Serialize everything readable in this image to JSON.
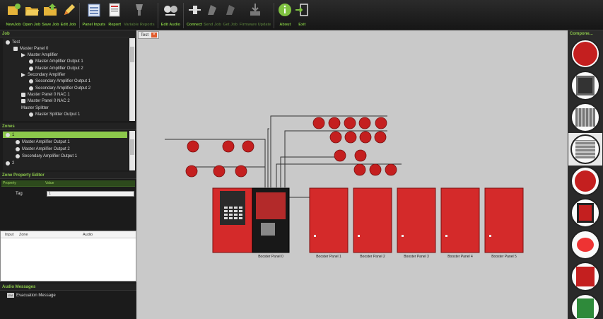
{
  "toolbar": {
    "buttons": [
      {
        "label": "NewJob",
        "icon": "new-job-icon",
        "enabled": true
      },
      {
        "label": "Open Job",
        "icon": "folder-open-icon",
        "enabled": true
      },
      {
        "label": "Save Job",
        "icon": "save-job-icon",
        "enabled": true
      },
      {
        "label": "Edit Job",
        "icon": "pencil-icon",
        "enabled": true
      },
      {
        "label": "Panel Inputs",
        "icon": "panel-inputs-icon",
        "enabled": true
      },
      {
        "label": "Report",
        "icon": "report-icon",
        "enabled": true
      },
      {
        "label": "Variable Reports",
        "icon": "variable-reports-icon",
        "enabled": false
      },
      {
        "label": "Edit Audio",
        "icon": "edit-audio-icon",
        "enabled": true
      },
      {
        "label": "Connect",
        "icon": "connect-plug-icon",
        "enabled": true
      },
      {
        "label": "Send Job",
        "icon": "send-job-icon",
        "enabled": false
      },
      {
        "label": "Get Job",
        "icon": "get-job-icon",
        "enabled": false
      },
      {
        "label": "Firmware Update",
        "icon": "firmware-update-icon",
        "enabled": false
      },
      {
        "label": "About",
        "icon": "info-icon",
        "enabled": true
      },
      {
        "label": "Exit",
        "icon": "exit-door-icon",
        "enabled": true
      }
    ]
  },
  "job_panel": {
    "title": "Job",
    "items": [
      {
        "label": "Test",
        "indent": 0,
        "icon": "wrench"
      },
      {
        "label": "Master Panel 0",
        "indent": 1,
        "icon": "panel"
      },
      {
        "label": "Master Amplifier",
        "indent": 2,
        "icon": "amp"
      },
      {
        "label": "Master Amplifier Output 1",
        "indent": 3,
        "icon": "out"
      },
      {
        "label": "Master Amplifier Output 2",
        "indent": 3,
        "icon": "out"
      },
      {
        "label": "Secondary Amplifier",
        "indent": 2,
        "icon": "amp"
      },
      {
        "label": "Secondary Amplifier Output 1",
        "indent": 3,
        "icon": "out"
      },
      {
        "label": "Secondary Amplifier Output 2",
        "indent": 3,
        "icon": "out"
      },
      {
        "label": "Master Panel 0 NAC 1",
        "indent": 2,
        "icon": "nac"
      },
      {
        "label": "Master Panel 0 NAC 2",
        "indent": 2,
        "icon": "nac"
      },
      {
        "label": "Master Splitter",
        "indent": 2,
        "icon": "none"
      },
      {
        "label": "Master Splitter Output 1",
        "indent": 3,
        "icon": "out"
      }
    ]
  },
  "zones_panel": {
    "title": "Zones",
    "items": [
      {
        "label": "1",
        "selected": true
      },
      {
        "label": "Master Amplifier Output 1",
        "selected": false
      },
      {
        "label": "Master Amplifier Output 2",
        "selected": false
      },
      {
        "label": "Secondary Amplifier Output 1",
        "selected": false
      },
      {
        "label": "2",
        "selected": false
      }
    ]
  },
  "zone_property_editor": {
    "title": "Zone Property Editor",
    "col_property": "Property",
    "col_value": "Value",
    "rows": [
      {
        "property": "Tag",
        "value": "1"
      }
    ]
  },
  "inputs_table": {
    "columns": [
      "Input",
      "Zone",
      "Audio"
    ]
  },
  "audio_messages": {
    "title": "Audio Messages",
    "items": [
      {
        "badge": "EM",
        "label": "Evacuation Message"
      }
    ]
  },
  "document_tab": {
    "label": "Test"
  },
  "diagram": {
    "master_label": "Booster Panel 0",
    "booster_labels": [
      "Booster Panel 1",
      "Booster Panel 2",
      "Booster Panel 3",
      "Booster Panel 4",
      "Booster Panel 5"
    ],
    "panel_color": "#d42a2a",
    "device_color": "#c41f1f"
  },
  "components_panel": {
    "title": "Compone...",
    "items": [
      "horn-strobe-component",
      "panel-component",
      "speaker-grid-component",
      "speaker-box-component",
      "red-device-component",
      "module-component",
      "light-component",
      "red-panel-component",
      "green-device-component"
    ]
  }
}
